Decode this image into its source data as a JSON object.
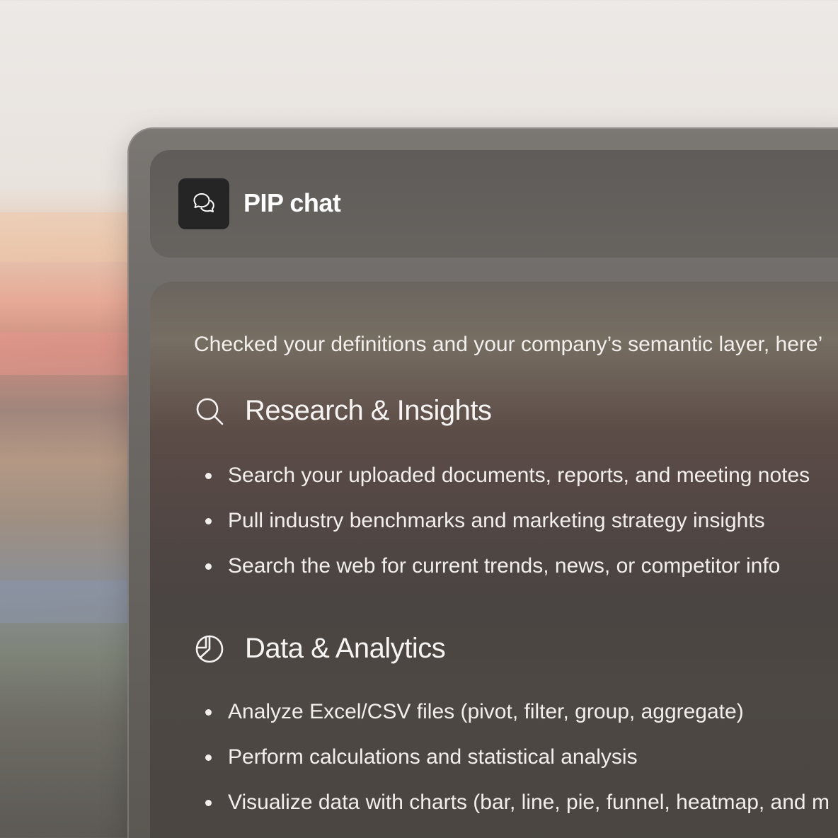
{
  "header": {
    "title": "PIP chat",
    "logo_icon": "chat-bubbles-icon"
  },
  "message": {
    "intro": "Checked your definitions and your company’s semantic layer, here’"
  },
  "sections": [
    {
      "icon": "search-icon",
      "title": "Research & Insights",
      "items": [
        "Search your uploaded documents, reports, and meeting notes",
        "Pull industry benchmarks and marketing strategy insights",
        "Search the web for current trends, news, or competitor info"
      ]
    },
    {
      "icon": "pie-chart-icon",
      "title": "Data & Analytics",
      "items": [
        "Analyze Excel/CSV files (pivot, filter, group, aggregate)",
        "Perform calculations and statistical analysis",
        "Visualize data with charts (bar, line, pie, funnel, heatmap, and m"
      ]
    }
  ]
}
